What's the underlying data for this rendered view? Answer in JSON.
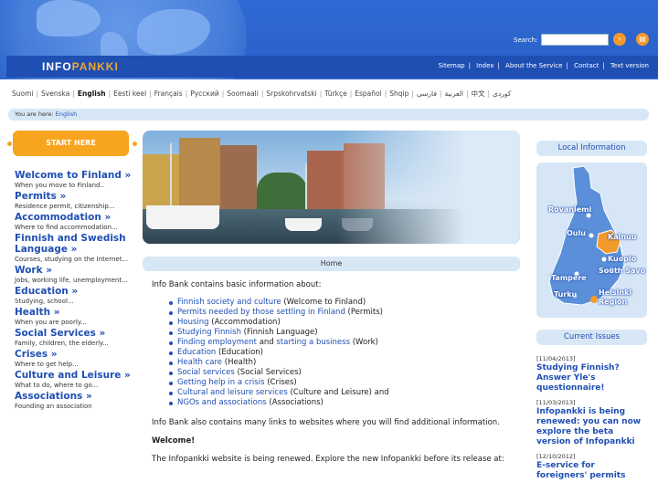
{
  "header": {
    "brand_a": "INFO",
    "brand_b": "PANKKI",
    "search_label": "Search:",
    "search_value": "",
    "search_go_icon": "arrow-right-icon",
    "print_icon": "printer-icon",
    "top_nav": [
      "Sitemap",
      "Index",
      "About the Service",
      "Contact",
      "Text version"
    ]
  },
  "languages": {
    "items": [
      "Suomi",
      "Svenska",
      "English",
      "Eesti keel",
      "Français",
      "Русский",
      "Soomaali",
      "Srpskohrvatski",
      "Türkçe",
      "Español",
      "Shqip",
      "العربية",
      "فارسی",
      "中文",
      "کوردی"
    ],
    "active": "English"
  },
  "breadcrumb": {
    "label": "You are here:",
    "current": "English"
  },
  "start_here": "START HERE",
  "left_nav": [
    {
      "title": "Welcome to Finland »",
      "desc": "When you move to Finland.."
    },
    {
      "title": "Permits »",
      "desc": "Residence permit, citizenship..."
    },
    {
      "title": "Accommodation »",
      "desc": "Where to find accommodation..."
    },
    {
      "title": "Finnish and Swedish Language »",
      "desc": "Courses, studying on the Internet..."
    },
    {
      "title": "Work »",
      "desc": "Jobs, working life, unemployment..."
    },
    {
      "title": "Education »",
      "desc": "Studying, school..."
    },
    {
      "title": "Health »",
      "desc": "When you are poorly..."
    },
    {
      "title": "Social Services »",
      "desc": "Family, children, the elderly..."
    },
    {
      "title": "Crises »",
      "desc": "Where to get help..."
    },
    {
      "title": "Culture and Leisure »",
      "desc": "What to do, where to go..."
    },
    {
      "title": "Associations »",
      "desc": "Founding an association"
    }
  ],
  "main": {
    "home_label": "Home",
    "intro": "Info Bank contains basic information about:",
    "topics": [
      {
        "link": "Finnish society and culture",
        "rest": " (Welcome to Finland)"
      },
      {
        "link": "Permits needed by those settling in Finland",
        "rest": " (Permits)"
      },
      {
        "link": "Housing",
        "rest": " (Accommodation)"
      },
      {
        "link": "Studying Finnish",
        "rest": " (Finnish Language)"
      },
      {
        "link": "Finding employment",
        "mid": " and ",
        "link2": "starting a business",
        "rest": " (Work)"
      },
      {
        "link": "Education",
        "rest": " (Education)"
      },
      {
        "link": "Health care",
        "rest": " (Health)"
      },
      {
        "link": "Social services",
        "rest": " (Social Services)"
      },
      {
        "link": "Getting help in a crisis",
        "rest": " (Crises)"
      },
      {
        "link": "Cultural and leisure services",
        "rest": " (Culture and Leisure) and"
      },
      {
        "link": "NGOs and associations",
        "rest": " (Associations)"
      }
    ],
    "links_note": "Info Bank also contains many links to websites where you will find additional information.",
    "welcome": "Welcome!",
    "renewal_note": "The Infopankki website is being renewed. Explore the new Infopankki before its release at:"
  },
  "right": {
    "local_info_title": "Local Information",
    "cities": [
      "Rovaniemi",
      "Oulu",
      "Kainuu",
      "Kuopio",
      "South Savo",
      "Tampere",
      "Helsinki Region",
      "Turku"
    ],
    "current_issues_title": "Current Issues",
    "issues": [
      {
        "date": "[11/04/2013]",
        "title": "Studying Finnish? Answer Yle's questionnaire!"
      },
      {
        "date": "[11/03/2013]",
        "title": "Infopankki is being renewed: you can now explore the beta version of Infopankki"
      },
      {
        "date": "[12/10/2012]",
        "title": "E-service for foreigners' permits"
      }
    ]
  },
  "colors": {
    "header_blue": "#2f6ad4",
    "nav_blue": "#1f4fb3",
    "accent_orange": "#f7a51f",
    "light_panel": "#d8e7f6"
  }
}
